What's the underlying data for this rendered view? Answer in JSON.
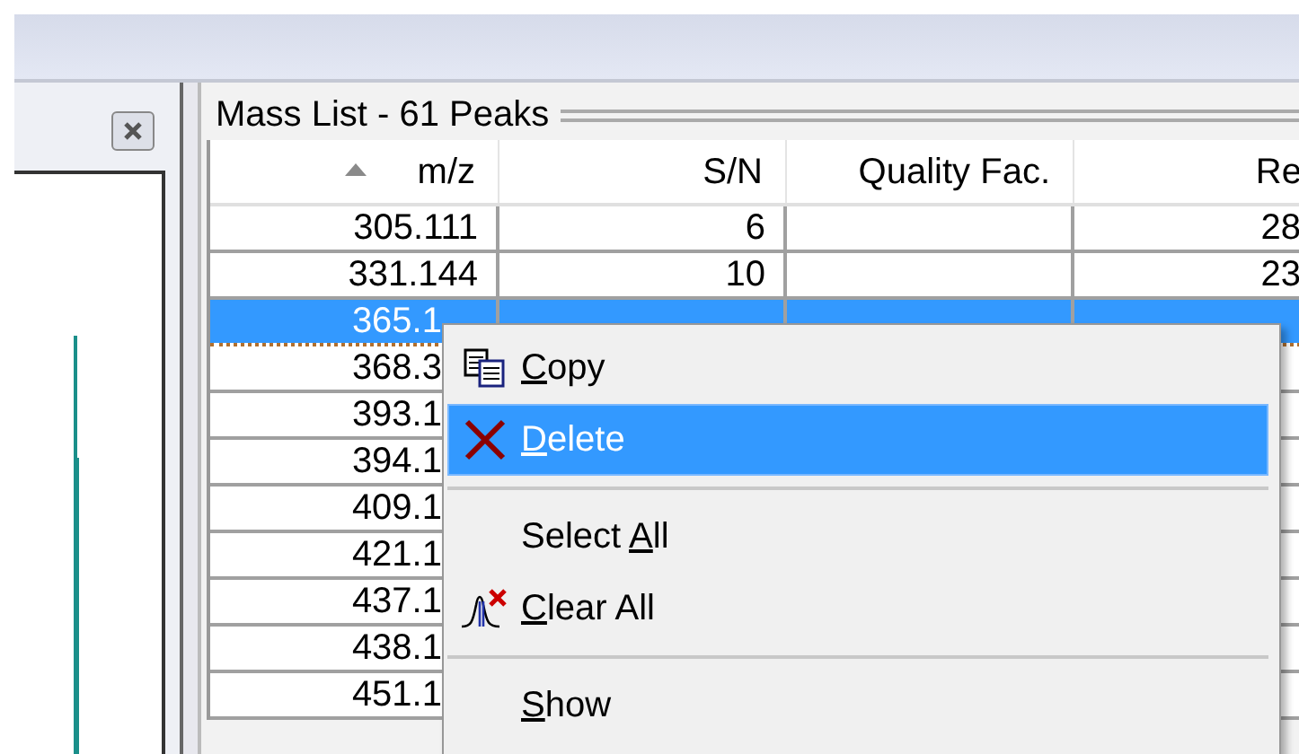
{
  "mass_list": {
    "title": "Mass List - 61 Peaks",
    "columns": [
      {
        "label": "m/z",
        "sorted": true
      },
      {
        "label": "S/N",
        "sorted": false
      },
      {
        "label": "Quality Fac.",
        "sorted": false
      },
      {
        "label": "Re",
        "sorted": false
      }
    ],
    "rows": [
      {
        "selected": false,
        "cells": [
          "305.111",
          "6",
          null,
          "28"
        ]
      },
      {
        "selected": false,
        "cells": [
          "331.144",
          "10",
          null,
          "23"
        ]
      },
      {
        "selected": true,
        "cells": [
          "365.1"
        ]
      },
      {
        "selected": false,
        "cells": [
          "368.3"
        ]
      },
      {
        "selected": false,
        "cells": [
          "393.1"
        ]
      },
      {
        "selected": false,
        "cells": [
          "394.1"
        ]
      },
      {
        "selected": false,
        "cells": [
          "409.1"
        ]
      },
      {
        "selected": false,
        "cells": [
          "421.1"
        ]
      },
      {
        "selected": false,
        "cells": [
          "437.1"
        ]
      },
      {
        "selected": false,
        "cells": [
          "438.1"
        ]
      },
      {
        "selected": false,
        "cells": [
          "451.1"
        ]
      }
    ]
  },
  "context_menu": {
    "items": [
      {
        "kind": "item",
        "key": "C",
        "after": "opy",
        "selected": false
      },
      {
        "kind": "item",
        "key": "D",
        "after": "elete",
        "selected": true
      },
      {
        "kind": "separator"
      },
      {
        "kind": "item",
        "before": "Select ",
        "key": "A",
        "after": "ll",
        "selected": false
      },
      {
        "kind": "item",
        "key": "C",
        "after": "lear All",
        "selected": false
      },
      {
        "kind": "separator"
      },
      {
        "kind": "item",
        "key": "S",
        "after": "how",
        "selected": false
      }
    ]
  }
}
